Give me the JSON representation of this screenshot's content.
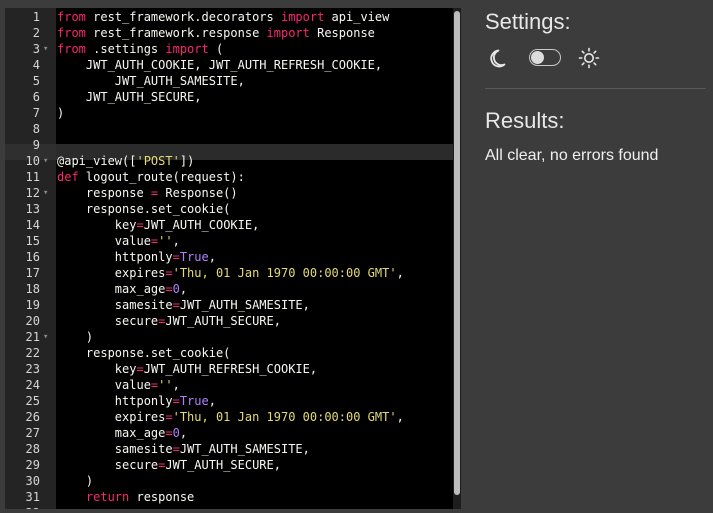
{
  "editor": {
    "lines": [
      [
        {
          "t": "from ",
          "c": "kw"
        },
        {
          "t": "rest_framework.decorators "
        },
        {
          "t": "import ",
          "c": "kw"
        },
        {
          "t": "api_view"
        }
      ],
      [
        {
          "t": "from ",
          "c": "kw"
        },
        {
          "t": "rest_framework.response "
        },
        {
          "t": "import ",
          "c": "kw"
        },
        {
          "t": "Response"
        }
      ],
      [
        {
          "t": "from ",
          "c": "kw"
        },
        {
          "t": ".settings "
        },
        {
          "t": "import ",
          "c": "kw"
        },
        {
          "t": "("
        }
      ],
      [
        {
          "t": "    JWT_AUTH_COOKIE, JWT_AUTH_REFRESH_COOKIE,"
        }
      ],
      [
        {
          "t": "        JWT_AUTH_SAMESITE,"
        }
      ],
      [
        {
          "t": "    JWT_AUTH_SECURE,"
        }
      ],
      [
        {
          "t": ")"
        }
      ],
      [],
      [],
      [
        {
          "t": "@api_view(["
        },
        {
          "t": "'POST'",
          "c": "str"
        },
        {
          "t": "])"
        }
      ],
      [
        {
          "t": "def ",
          "c": "kw"
        },
        {
          "t": "logout_route(request):"
        }
      ],
      [
        {
          "t": "    response "
        },
        {
          "t": "=",
          "c": "kw"
        },
        {
          "t": " Response()"
        }
      ],
      [
        {
          "t": "    response.set_cookie("
        }
      ],
      [
        {
          "t": "        key"
        },
        {
          "t": "=",
          "c": "kw"
        },
        {
          "t": "JWT_AUTH_COOKIE,"
        }
      ],
      [
        {
          "t": "        value"
        },
        {
          "t": "=",
          "c": "kw"
        },
        {
          "t": "''",
          "c": "str"
        },
        {
          "t": ","
        }
      ],
      [
        {
          "t": "        httponly"
        },
        {
          "t": "=",
          "c": "kw"
        },
        {
          "t": "True",
          "c": "cst"
        },
        {
          "t": ","
        }
      ],
      [
        {
          "t": "        expires"
        },
        {
          "t": "=",
          "c": "kw"
        },
        {
          "t": "'Thu, 01 Jan 1970 00:00:00 GMT'",
          "c": "str"
        },
        {
          "t": ","
        }
      ],
      [
        {
          "t": "        max_age"
        },
        {
          "t": "=",
          "c": "kw"
        },
        {
          "t": "0",
          "c": "cst"
        },
        {
          "t": ","
        }
      ],
      [
        {
          "t": "        samesite"
        },
        {
          "t": "=",
          "c": "kw"
        },
        {
          "t": "JWT_AUTH_SAMESITE,"
        }
      ],
      [
        {
          "t": "        secure"
        },
        {
          "t": "=",
          "c": "kw"
        },
        {
          "t": "JWT_AUTH_SECURE,"
        }
      ],
      [
        {
          "t": "    )"
        }
      ],
      [
        {
          "t": "    response.set_cookie("
        }
      ],
      [
        {
          "t": "        key"
        },
        {
          "t": "=",
          "c": "kw"
        },
        {
          "t": "JWT_AUTH_REFRESH_COOKIE,"
        }
      ],
      [
        {
          "t": "        value"
        },
        {
          "t": "=",
          "c": "kw"
        },
        {
          "t": "''",
          "c": "str"
        },
        {
          "t": ","
        }
      ],
      [
        {
          "t": "        httponly"
        },
        {
          "t": "=",
          "c": "kw"
        },
        {
          "t": "True",
          "c": "cst"
        },
        {
          "t": ","
        }
      ],
      [
        {
          "t": "        expires"
        },
        {
          "t": "=",
          "c": "kw"
        },
        {
          "t": "'Thu, 01 Jan 1970 00:00:00 GMT'",
          "c": "str"
        },
        {
          "t": ","
        }
      ],
      [
        {
          "t": "        max_age"
        },
        {
          "t": "=",
          "c": "kw"
        },
        {
          "t": "0",
          "c": "cst"
        },
        {
          "t": ","
        }
      ],
      [
        {
          "t": "        samesite"
        },
        {
          "t": "=",
          "c": "kw"
        },
        {
          "t": "JWT_AUTH_SAMESITE,"
        }
      ],
      [
        {
          "t": "        secure"
        },
        {
          "t": "=",
          "c": "kw"
        },
        {
          "t": "JWT_AUTH_SECURE,"
        }
      ],
      [
        {
          "t": "    )"
        }
      ],
      [
        {
          "t": "    return ",
          "c": "kw"
        },
        {
          "t": "response"
        }
      ],
      []
    ],
    "fold_lines": [
      3,
      10,
      12,
      21
    ],
    "active_line": 8,
    "fold_marker": "▾"
  },
  "settings": {
    "title": "Settings:",
    "moon_icon": "moon-icon",
    "sun_icon": "sun-icon",
    "toggle_on": false
  },
  "results": {
    "title": "Results:",
    "message": "All clear, no errors found"
  },
  "colors": {
    "keyword": "#f92672",
    "string": "#e6db74",
    "constant": "#ae81ff",
    "text": "#f8f8f2"
  }
}
